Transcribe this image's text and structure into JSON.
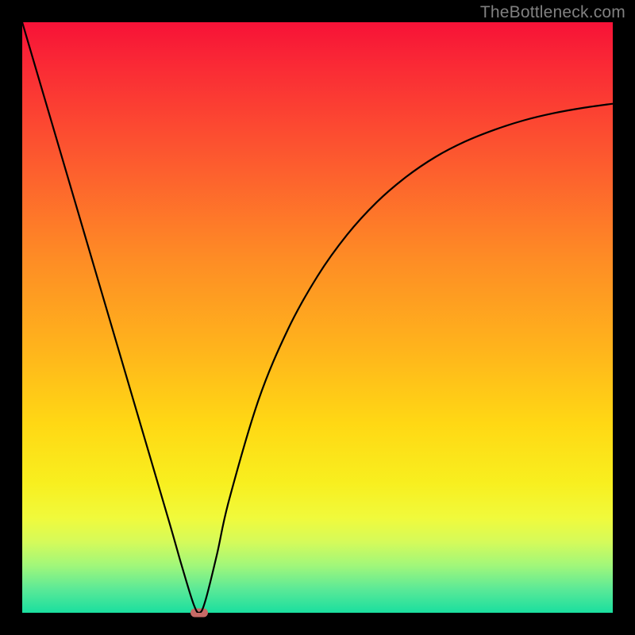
{
  "watermark": "TheBottleneck.com",
  "chart_data": {
    "type": "line",
    "title": "",
    "xlabel": "",
    "ylabel": "",
    "xlim": [
      0,
      100
    ],
    "ylim": [
      0,
      100
    ],
    "x": [
      0,
      5,
      10,
      15,
      20,
      25,
      27,
      29,
      30,
      31,
      33,
      35,
      40,
      45,
      50,
      55,
      60,
      65,
      70,
      75,
      80,
      85,
      90,
      95,
      100
    ],
    "values": [
      100,
      83,
      66,
      49,
      32,
      15,
      8,
      1.5,
      0,
      2,
      10,
      19,
      36,
      48,
      57,
      64,
      69.5,
      73.8,
      77.2,
      79.8,
      81.8,
      83.4,
      84.6,
      85.5,
      86.2
    ],
    "series": [
      {
        "name": "bottleneck-curve",
        "color": "#000000"
      }
    ],
    "marker": {
      "x": 30,
      "y": 0,
      "color": "#c76a66"
    },
    "background_gradient": [
      "#f71237",
      "#ffd814",
      "#1adf9f"
    ]
  }
}
